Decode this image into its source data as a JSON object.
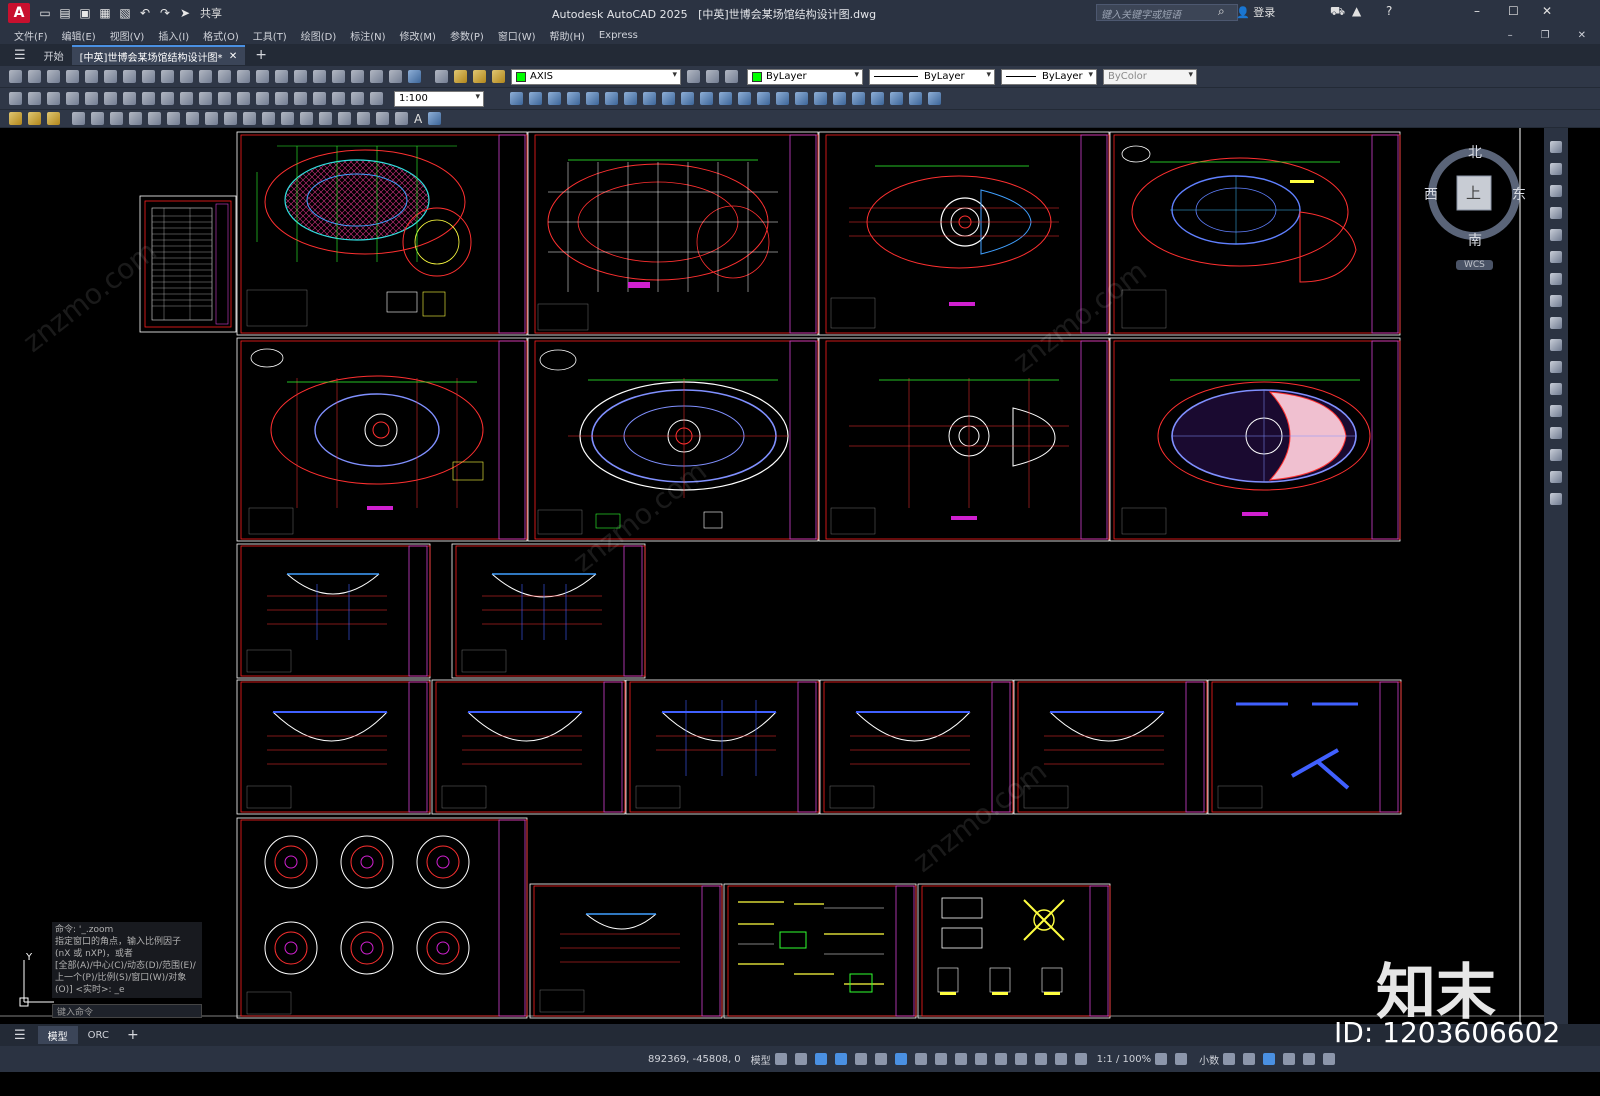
{
  "app": {
    "title": "Autodesk AutoCAD 2025",
    "file": "[中英]世博会某场馆结构设计图.dwg",
    "logo": "A",
    "share": "共享",
    "search_placeholder": "键入关键字或短语",
    "login": "登录"
  },
  "menu": [
    "文件(F)",
    "编辑(E)",
    "视图(V)",
    "插入(I)",
    "格式(O)",
    "工具(T)",
    "绘图(D)",
    "标注(N)",
    "修改(M)",
    "参数(P)",
    "窗口(W)",
    "帮助(H)",
    "Express"
  ],
  "tabs": [
    {
      "label": "开始"
    },
    {
      "label": "[中英]世博会某场馆结构设计图*"
    }
  ],
  "properties": {
    "layer": "AXIS",
    "color": "ByLayer",
    "linetype": "ByLayer",
    "lineweight": "ByLayer",
    "plotstyle": "ByColor",
    "scale": "1:100",
    "colors": {
      "layer_swatch": "#00ff00",
      "color_swatch": "#00ff00"
    }
  },
  "viewcube": {
    "north": "北",
    "south": "南",
    "east": "东",
    "west": "西",
    "top": "上",
    "wcs": "WCS"
  },
  "command": {
    "history": [
      "命令: '_.zoom",
      "指定窗口的角点，输入比例因子 (nX 或 nXP)，或者",
      "[全部(A)/中心(C)/动态(D)/范围(E)/上一个(P)/比例(S)/窗口(W)/对象(O)] <实时>: _e"
    ],
    "input_placeholder": "键入命令"
  },
  "layout_tabs": [
    {
      "label": "模型"
    },
    {
      "label": "ORC"
    }
  ],
  "status": {
    "coords": "892369, -45808, 0",
    "mode": "模型",
    "scale": "1:1 / 100%",
    "units": "小数"
  },
  "watermark": {
    "brand": "知末",
    "id": "ID: 1203606602"
  }
}
